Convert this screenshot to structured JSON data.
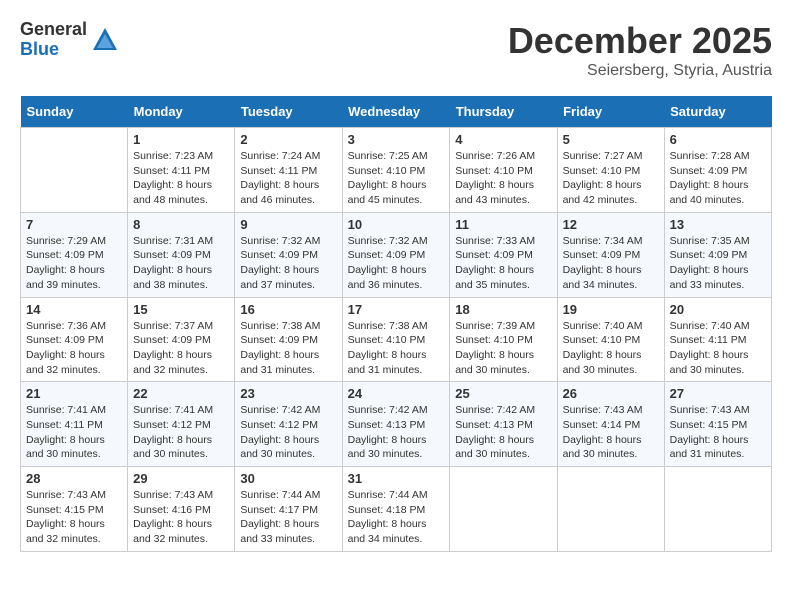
{
  "logo": {
    "general": "General",
    "blue": "Blue"
  },
  "title": "December 2025",
  "location": "Seiersberg, Styria, Austria",
  "weekdays": [
    "Sunday",
    "Monday",
    "Tuesday",
    "Wednesday",
    "Thursday",
    "Friday",
    "Saturday"
  ],
  "weeks": [
    [
      {
        "day": "",
        "info": ""
      },
      {
        "day": "1",
        "info": "Sunrise: 7:23 AM\nSunset: 4:11 PM\nDaylight: 8 hours\nand 48 minutes."
      },
      {
        "day": "2",
        "info": "Sunrise: 7:24 AM\nSunset: 4:11 PM\nDaylight: 8 hours\nand 46 minutes."
      },
      {
        "day": "3",
        "info": "Sunrise: 7:25 AM\nSunset: 4:10 PM\nDaylight: 8 hours\nand 45 minutes."
      },
      {
        "day": "4",
        "info": "Sunrise: 7:26 AM\nSunset: 4:10 PM\nDaylight: 8 hours\nand 43 minutes."
      },
      {
        "day": "5",
        "info": "Sunrise: 7:27 AM\nSunset: 4:10 PM\nDaylight: 8 hours\nand 42 minutes."
      },
      {
        "day": "6",
        "info": "Sunrise: 7:28 AM\nSunset: 4:09 PM\nDaylight: 8 hours\nand 40 minutes."
      }
    ],
    [
      {
        "day": "7",
        "info": "Sunrise: 7:29 AM\nSunset: 4:09 PM\nDaylight: 8 hours\nand 39 minutes."
      },
      {
        "day": "8",
        "info": "Sunrise: 7:31 AM\nSunset: 4:09 PM\nDaylight: 8 hours\nand 38 minutes."
      },
      {
        "day": "9",
        "info": "Sunrise: 7:32 AM\nSunset: 4:09 PM\nDaylight: 8 hours\nand 37 minutes."
      },
      {
        "day": "10",
        "info": "Sunrise: 7:32 AM\nSunset: 4:09 PM\nDaylight: 8 hours\nand 36 minutes."
      },
      {
        "day": "11",
        "info": "Sunrise: 7:33 AM\nSunset: 4:09 PM\nDaylight: 8 hours\nand 35 minutes."
      },
      {
        "day": "12",
        "info": "Sunrise: 7:34 AM\nSunset: 4:09 PM\nDaylight: 8 hours\nand 34 minutes."
      },
      {
        "day": "13",
        "info": "Sunrise: 7:35 AM\nSunset: 4:09 PM\nDaylight: 8 hours\nand 33 minutes."
      }
    ],
    [
      {
        "day": "14",
        "info": "Sunrise: 7:36 AM\nSunset: 4:09 PM\nDaylight: 8 hours\nand 32 minutes."
      },
      {
        "day": "15",
        "info": "Sunrise: 7:37 AM\nSunset: 4:09 PM\nDaylight: 8 hours\nand 32 minutes."
      },
      {
        "day": "16",
        "info": "Sunrise: 7:38 AM\nSunset: 4:09 PM\nDaylight: 8 hours\nand 31 minutes."
      },
      {
        "day": "17",
        "info": "Sunrise: 7:38 AM\nSunset: 4:10 PM\nDaylight: 8 hours\nand 31 minutes."
      },
      {
        "day": "18",
        "info": "Sunrise: 7:39 AM\nSunset: 4:10 PM\nDaylight: 8 hours\nand 30 minutes."
      },
      {
        "day": "19",
        "info": "Sunrise: 7:40 AM\nSunset: 4:10 PM\nDaylight: 8 hours\nand 30 minutes."
      },
      {
        "day": "20",
        "info": "Sunrise: 7:40 AM\nSunset: 4:11 PM\nDaylight: 8 hours\nand 30 minutes."
      }
    ],
    [
      {
        "day": "21",
        "info": "Sunrise: 7:41 AM\nSunset: 4:11 PM\nDaylight: 8 hours\nand 30 minutes."
      },
      {
        "day": "22",
        "info": "Sunrise: 7:41 AM\nSunset: 4:12 PM\nDaylight: 8 hours\nand 30 minutes."
      },
      {
        "day": "23",
        "info": "Sunrise: 7:42 AM\nSunset: 4:12 PM\nDaylight: 8 hours\nand 30 minutes."
      },
      {
        "day": "24",
        "info": "Sunrise: 7:42 AM\nSunset: 4:13 PM\nDaylight: 8 hours\nand 30 minutes."
      },
      {
        "day": "25",
        "info": "Sunrise: 7:42 AM\nSunset: 4:13 PM\nDaylight: 8 hours\nand 30 minutes."
      },
      {
        "day": "26",
        "info": "Sunrise: 7:43 AM\nSunset: 4:14 PM\nDaylight: 8 hours\nand 30 minutes."
      },
      {
        "day": "27",
        "info": "Sunrise: 7:43 AM\nSunset: 4:15 PM\nDaylight: 8 hours\nand 31 minutes."
      }
    ],
    [
      {
        "day": "28",
        "info": "Sunrise: 7:43 AM\nSunset: 4:15 PM\nDaylight: 8 hours\nand 32 minutes."
      },
      {
        "day": "29",
        "info": "Sunrise: 7:43 AM\nSunset: 4:16 PM\nDaylight: 8 hours\nand 32 minutes."
      },
      {
        "day": "30",
        "info": "Sunrise: 7:44 AM\nSunset: 4:17 PM\nDaylight: 8 hours\nand 33 minutes."
      },
      {
        "day": "31",
        "info": "Sunrise: 7:44 AM\nSunset: 4:18 PM\nDaylight: 8 hours\nand 34 minutes."
      },
      {
        "day": "",
        "info": ""
      },
      {
        "day": "",
        "info": ""
      },
      {
        "day": "",
        "info": ""
      }
    ]
  ]
}
